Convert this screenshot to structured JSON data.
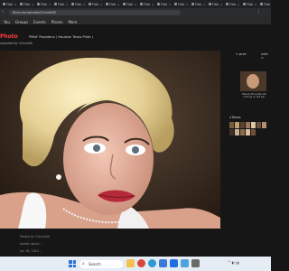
{
  "browser": {
    "tabs": [
      "Flick",
      "Flick",
      "Flick",
      "Flick",
      "Flick",
      "Flick",
      "Flick",
      "Flick",
      "Flick",
      "Flick",
      "Flick",
      "Flick",
      "Flick",
      "Flick",
      "Flick",
      "Flick"
    ],
    "url": "flickr.com/photos/ChinnbSK"
  },
  "site": {
    "nav": [
      "You",
      "Groups",
      "Events",
      "Places",
      "More"
    ]
  },
  "photo_page": {
    "title": "Photo",
    "subtitle": "PMwF Pasadena ( Houston Texas Pride )",
    "byline": "uploaded by ChinnbSK"
  },
  "sidebar": {
    "prev": "< prev",
    "next": "next >",
    "caption": "Beauty Brunette sits looking on the bar",
    "thumbs_header": "4 Boxes"
  },
  "below": {
    "line1": "Posted by ChinnbSK",
    "line2": "tweets about ...",
    "line3": "Jun 26, 2015 ..."
  },
  "taskbar": {
    "search_placeholder": "Search"
  },
  "colors": {
    "title": "#ff3c3c",
    "bg": "#161616",
    "taskbar": "#e6ecf4"
  }
}
